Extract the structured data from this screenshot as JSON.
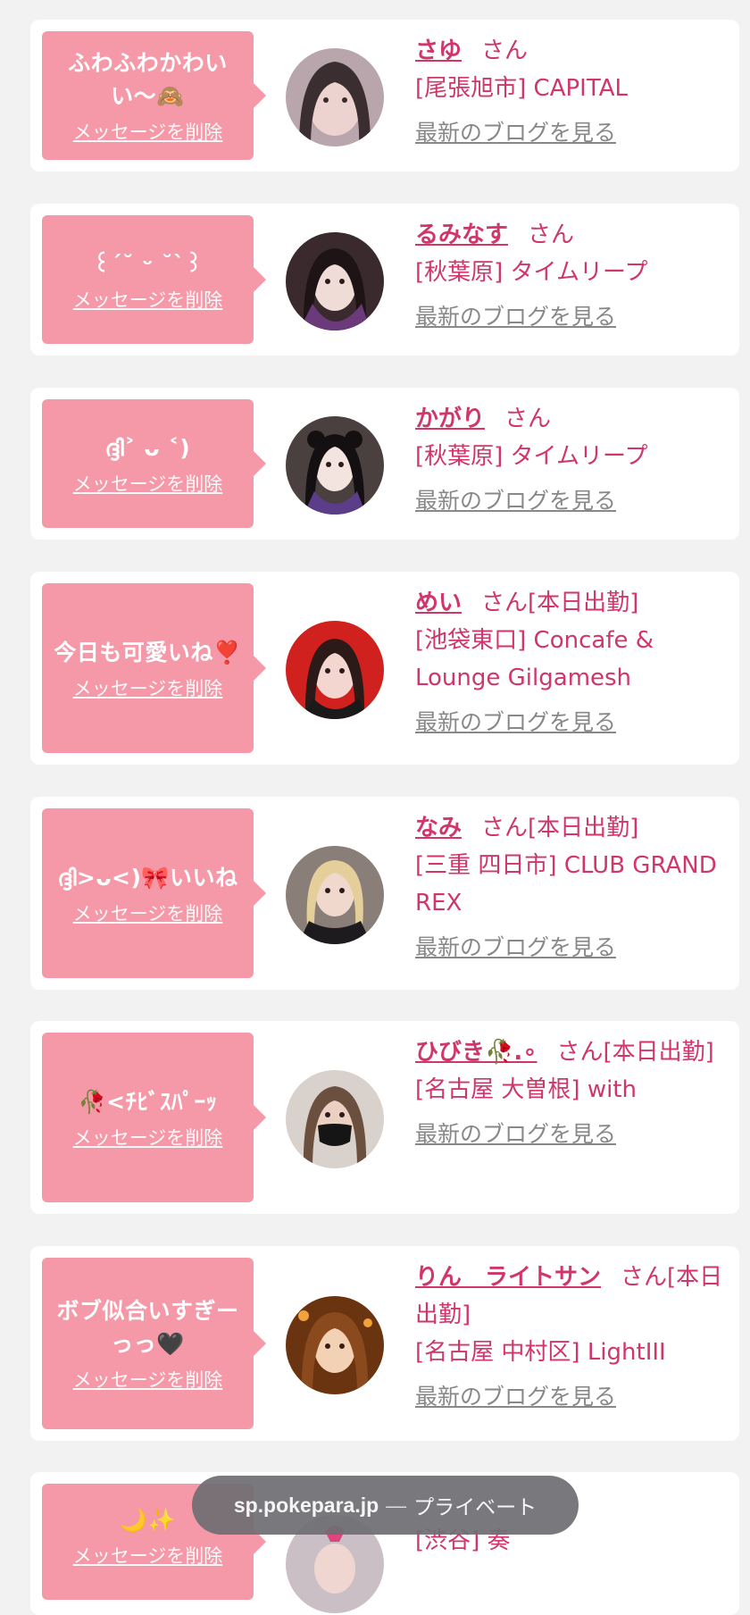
{
  "delete_label": "メッセージを削除",
  "blog_label": "最新のブログを見る",
  "san_suffix": "さん",
  "items": [
    {
      "message": "ふわふわかわいい〜🙈",
      "name": "さゆ",
      "suffix": "さん",
      "shop": "[尾張旭市] CAPITAL"
    },
    {
      "message": "꒰ˊ˘ ᵕ ˘ˋ꒱",
      "name": "るみなす",
      "suffix": "さん",
      "shop": "[秋葉原] タイムリープ"
    },
    {
      "message": "ദ്ദി˃ ᴗ ˂)",
      "name": "かがり",
      "suffix": "さん",
      "shop": "[秋葉原] タイムリープ"
    },
    {
      "message": "今日も可愛いね❣️",
      "name": "めい",
      "suffix": "さん[本日出勤]",
      "shop": "[池袋東口] Concafe & Lounge Gilgamesh"
    },
    {
      "message": "ദ്ദി>ᴗ<)🎀いいね",
      "name": "なみ",
      "suffix": "さん[本日出勤]",
      "shop": "[三重 四日市] CLUB GRAND REX"
    },
    {
      "message": "🥀<ﾁﾋﾞｽﾊﾟｰｯ",
      "name": "ひびき🥀.∘",
      "suffix": "さん[本日出勤]",
      "shop": "[名古屋 大曽根] with"
    },
    {
      "message": "ボブ似合いすぎーっっ🖤",
      "name": "りん　ライトサン",
      "suffix": "さん[本日出勤]",
      "shop": "[名古屋 中村区] LightIII"
    },
    {
      "message": "🌙✨",
      "name": "",
      "suffix": "",
      "shop": "[渋谷] 奏"
    }
  ],
  "toast": {
    "domain": "sp.pokepara.jp",
    "separator": "—",
    "mode": "プライベート"
  },
  "colors": {
    "bubble": "#f598a8",
    "accent": "#d0356b",
    "blog_link": "#888888",
    "background": "#f2f2f2"
  }
}
